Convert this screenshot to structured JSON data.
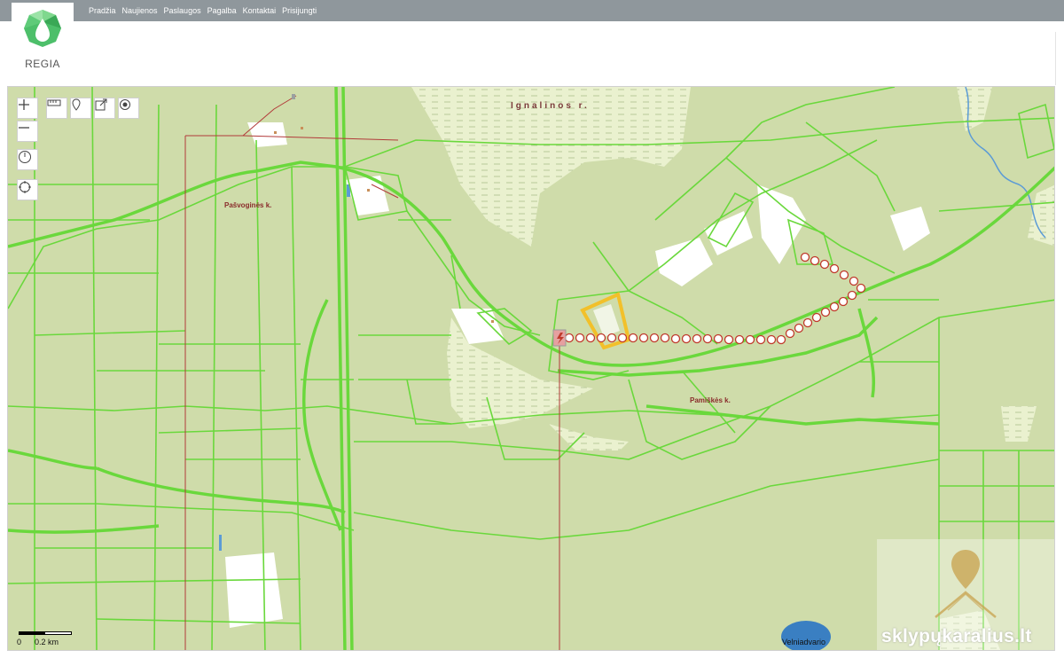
{
  "header": {
    "nav": [
      "Pradžia",
      "Naujienos",
      "Paslaugos",
      "Pagalba",
      "Kontaktai",
      "Prisijungti"
    ],
    "logo_text": "REGIA",
    "brand_color": "#4dbf6a",
    "bar_color": "#8f979c"
  },
  "map": {
    "labels": {
      "region": "Ignalinos r.",
      "village_west": "Pašvoginės k.",
      "village_east": "Pamiškės k.",
      "lake": "Velniadvario"
    },
    "scale": {
      "zero": "0",
      "distance": "0.2 km"
    },
    "watermark": "sklypųkaralius.lt",
    "colors": {
      "background": "#cfdcaa",
      "parcel_lines": "#6ad83c",
      "forest": "#e8efc8",
      "power_line": "#b23a3a",
      "highlight": "#f2c02a",
      "water": "#3a7fc2"
    }
  },
  "tools": [
    "zoom-in",
    "zoom-out",
    "measure",
    "marker",
    "export",
    "locate",
    "history",
    "target"
  ]
}
